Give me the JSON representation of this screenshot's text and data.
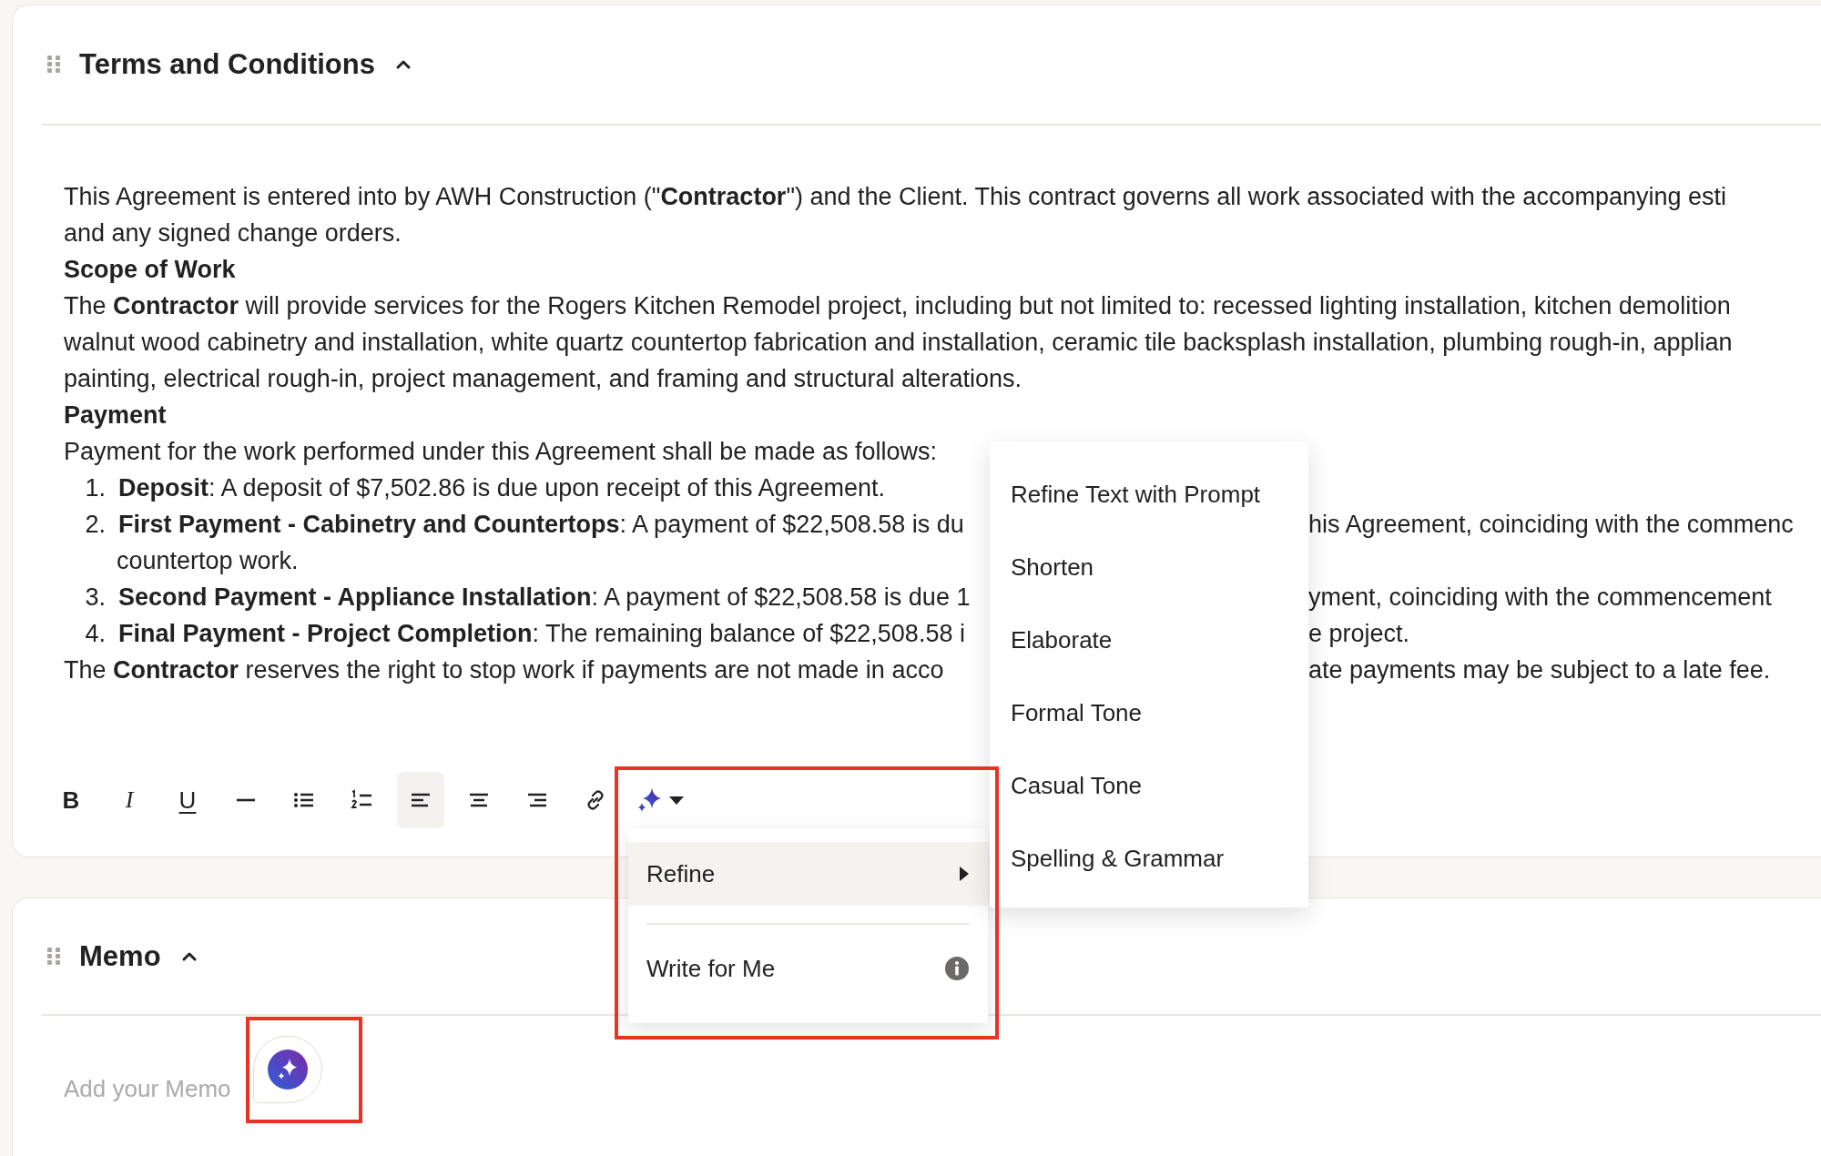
{
  "sections": [
    {
      "title": "Terms and Conditions",
      "expanded": true,
      "lines": [
        {
          "kind": "text",
          "text": "This Agreement is entered into by AWH Construction (\"**Contractor**\") and the Client. This contract governs all work associated with the accompanying esti"
        },
        {
          "kind": "text",
          "text": "and any signed change orders."
        },
        {
          "kind": "heading",
          "text": "Scope of Work"
        },
        {
          "kind": "text",
          "text": "The **Contractor** will provide services for the Rogers Kitchen Remodel project, including but not limited to: recessed lighting installation, kitchen demolition"
        },
        {
          "kind": "text",
          "text": "walnut wood cabinetry and installation, white quartz countertop fabrication and installation, ceramic tile backsplash installation, plumbing rough-in, applian"
        },
        {
          "kind": "text",
          "text": "painting, electrical rough-in, project management, and framing and structural alterations."
        },
        {
          "kind": "heading",
          "text": "Payment"
        },
        {
          "kind": "text",
          "text": "Payment for the work performed under this Agreement shall be made as follows:"
        },
        {
          "kind": "list_item",
          "number": "1.",
          "text": "**Deposit**: A deposit of $7,502.86 is due upon receipt of this Agreement."
        },
        {
          "kind": "list_item",
          "number": "2.",
          "text": "**First Payment - Cabinetry and Countertops**: A payment of $22,508.58 is du",
          "text_right": "his Agreement, coinciding with the commenc"
        },
        {
          "kind": "continuation",
          "text": "countertop work."
        },
        {
          "kind": "list_item",
          "number": "3.",
          "text": "**Second Payment - Appliance Installation**: A payment of $22,508.58 is due 1",
          "text_right": "yment, coinciding with the commencement"
        },
        {
          "kind": "list_item",
          "number": "4.",
          "text": "**Final Payment - Project Completion**: The remaining balance of $22,508.58 i",
          "text_right": "e project."
        },
        {
          "kind": "text",
          "text": "The **Contractor** reserves the right to stop work if payments are not made in acco",
          "text_right": "ate payments may be subject to a late fee."
        }
      ],
      "toolbar": [
        {
          "kind": "bold",
          "label": "B",
          "selected": false
        },
        {
          "kind": "italic",
          "label": "I",
          "selected": false
        },
        {
          "kind": "underline",
          "label": "U",
          "selected": false
        },
        {
          "kind": "rule",
          "selected": false
        },
        {
          "kind": "bullets",
          "selected": false
        },
        {
          "kind": "numbers",
          "selected": false
        },
        {
          "kind": "align_left",
          "selected": true
        },
        {
          "kind": "align_center",
          "selected": false
        },
        {
          "kind": "align_right",
          "selected": false
        },
        {
          "kind": "link",
          "selected": false
        },
        {
          "kind": "ai",
          "selected": false
        }
      ]
    },
    {
      "title": "Memo",
      "expanded": true,
      "placeholder": "Add your Memo"
    }
  ],
  "ai_menu": {
    "items": [
      {
        "kind": "submenu",
        "label": "Refine",
        "selected": true
      },
      {
        "kind": "info",
        "label": "Write for Me",
        "selected": false
      }
    ]
  },
  "refine_submenu": {
    "items": [
      "Refine Text with Prompt",
      "Shorten",
      "Elaborate",
      "Formal Tone",
      "Casual Tone",
      "Spelling & Grammar"
    ]
  }
}
